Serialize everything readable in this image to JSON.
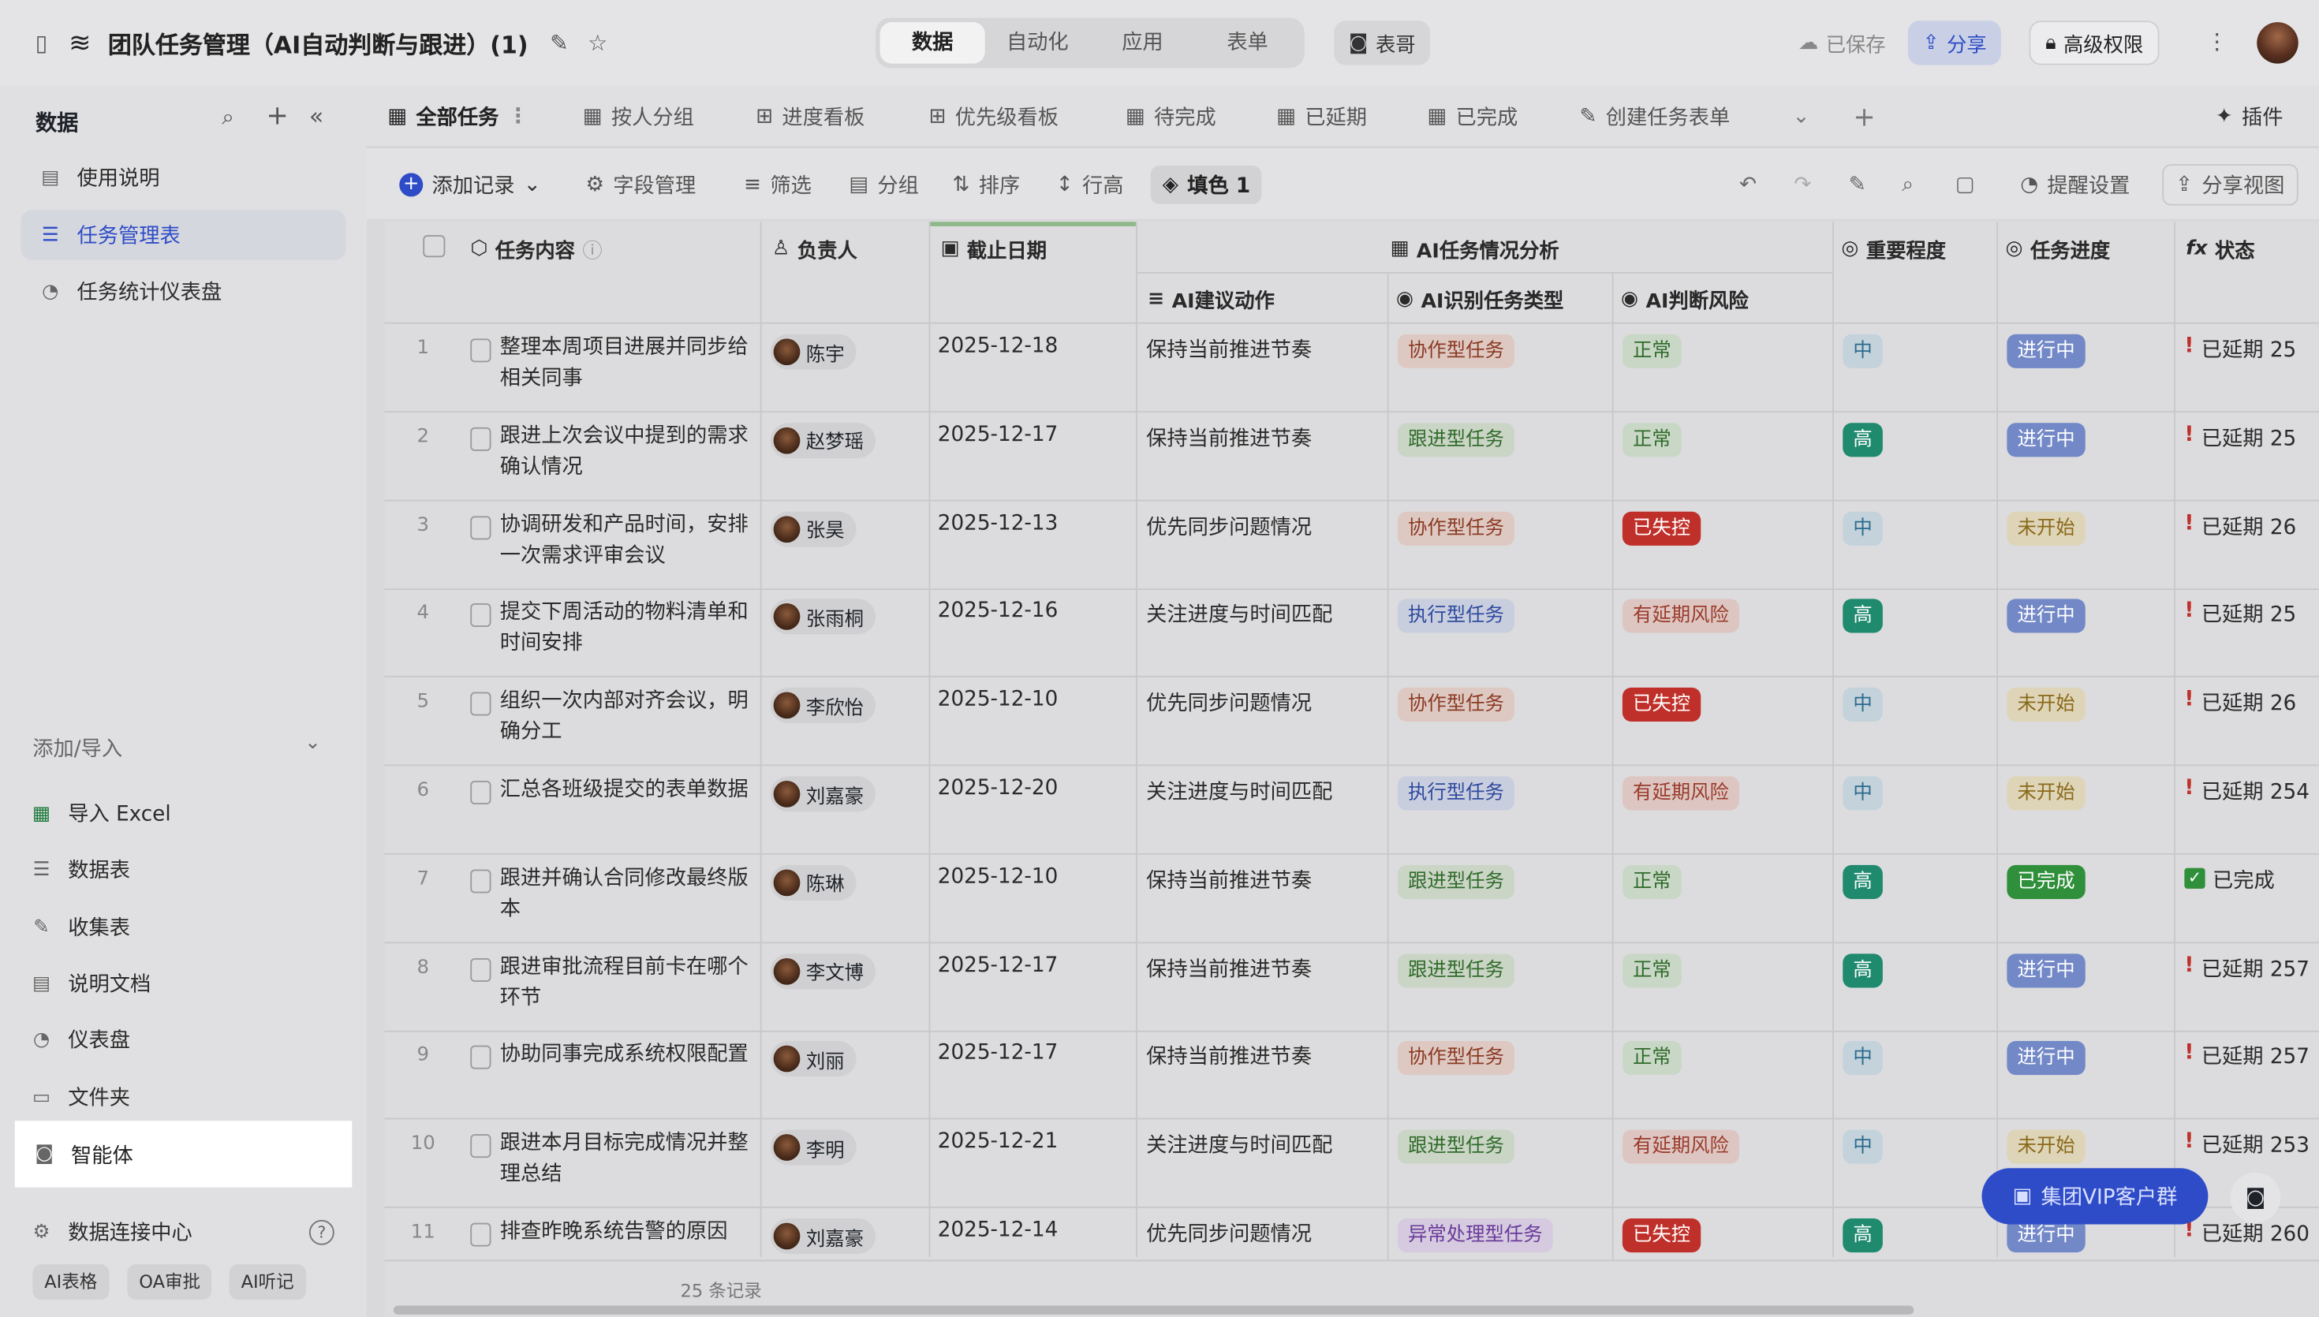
{
  "header": {
    "title": "团队任务管理（AI自动判断与跟进）(1)",
    "nav": [
      {
        "label": "数据",
        "active": true
      },
      {
        "label": "自动化"
      },
      {
        "label": "应用"
      },
      {
        "label": "表单"
      }
    ],
    "assistant": "表哥",
    "saved": "已保存",
    "share": "分享",
    "permission": "高级权限"
  },
  "sidebar": {
    "heading": "数据",
    "items": [
      {
        "label": "使用说明"
      },
      {
        "label": "任务管理表",
        "active": true
      },
      {
        "label": "任务统计仪表盘"
      }
    ],
    "add_import": "添加/导入",
    "create": [
      "导入 Excel",
      "数据表",
      "收集表",
      "说明文档",
      "仪表盘",
      "文件夹",
      "智能体"
    ],
    "connect": "数据连接中心",
    "tags": [
      "AI表格",
      "OA审批",
      "AI听记"
    ]
  },
  "tabs": [
    "全部任务",
    "按人分组",
    "进度看板",
    "优先级看板",
    "待完成",
    "已延期",
    "已完成",
    "创建任务表单"
  ],
  "plugin": "插件",
  "toolbar": {
    "add": "添加记录",
    "fields": "字段管理",
    "filter": "筛选",
    "group": "分组",
    "sort": "排序",
    "rowheight": "行高",
    "fill": "填色 1",
    "remind": "提醒设置",
    "shareview": "分享视图"
  },
  "columns": {
    "content": "任务内容",
    "owner": "负责人",
    "due": "截止日期",
    "ai_group": "AI任务情况分析",
    "ai_action": "AI建议动作",
    "ai_type": "AI识别任务类型",
    "ai_risk": "AI判断风险",
    "priority": "重要程度",
    "progress": "任务进度",
    "status": "状态"
  },
  "rows": [
    {
      "n": "1",
      "content": "整理本周项目进展并同步给相关同事",
      "owner": "陈宇",
      "due": "2025-12-18",
      "action": "保持当前推进节奏",
      "type": "协作型任务",
      "risk": "正常",
      "priority": "中",
      "progress": "进行中",
      "status": "已延期 25"
    },
    {
      "n": "2",
      "content": "跟进上次会议中提到的需求确认情况",
      "owner": "赵梦瑶",
      "due": "2025-12-17",
      "action": "保持当前推进节奏",
      "type": "跟进型任务",
      "risk": "正常",
      "priority": "高",
      "progress": "进行中",
      "status": "已延期 25"
    },
    {
      "n": "3",
      "content": "协调研发和产品时间，安排一次需求评审会议",
      "owner": "张昊",
      "due": "2025-12-13",
      "action": "优先同步问题情况",
      "type": "协作型任务",
      "risk": "已失控",
      "priority": "中",
      "progress": "未开始",
      "status": "已延期 26"
    },
    {
      "n": "4",
      "content": "提交下周活动的物料清单和时间安排",
      "owner": "张雨桐",
      "due": "2025-12-16",
      "action": "关注进度与时间匹配",
      "type": "执行型任务",
      "risk": "有延期风险",
      "priority": "高",
      "progress": "进行中",
      "status": "已延期 25"
    },
    {
      "n": "5",
      "content": "组织一次内部对齐会议，明确分工",
      "owner": "李欣怡",
      "due": "2025-12-10",
      "action": "优先同步问题情况",
      "type": "协作型任务",
      "risk": "已失控",
      "priority": "中",
      "progress": "未开始",
      "status": "已延期 26"
    },
    {
      "n": "6",
      "content": "汇总各班级提交的表单数据",
      "owner": "刘嘉豪",
      "due": "2025-12-20",
      "action": "关注进度与时间匹配",
      "type": "执行型任务",
      "risk": "有延期风险",
      "priority": "中",
      "progress": "未开始",
      "status": "已延期 254"
    },
    {
      "n": "7",
      "content": "跟进并确认合同修改最终版本",
      "owner": "陈琳",
      "due": "2025-12-10",
      "action": "保持当前推进节奏",
      "type": "跟进型任务",
      "risk": "正常",
      "priority": "高",
      "progress": "已完成",
      "status": "已完成"
    },
    {
      "n": "8",
      "content": "跟进审批流程目前卡在哪个环节",
      "owner": "李文博",
      "due": "2025-12-17",
      "action": "保持当前推进节奏",
      "type": "跟进型任务",
      "risk": "正常",
      "priority": "高",
      "progress": "进行中",
      "status": "已延期 257"
    },
    {
      "n": "9",
      "content": "协助同事完成系统权限配置",
      "owner": "刘丽",
      "due": "2025-12-17",
      "action": "保持当前推进节奏",
      "type": "协作型任务",
      "risk": "正常",
      "priority": "中",
      "progress": "进行中",
      "status": "已延期 257"
    },
    {
      "n": "10",
      "content": "跟进本月目标完成情况并整理总结",
      "owner": "李明",
      "due": "2025-12-21",
      "action": "关注进度与时间匹配",
      "type": "跟进型任务",
      "risk": "有延期风险",
      "priority": "中",
      "progress": "未开始",
      "status": "已延期 253"
    },
    {
      "n": "11",
      "content": "排查昨晚系统告警的原因",
      "owner": "刘嘉豪",
      "due": "2025-12-14",
      "action": "优先同步问题情况",
      "type": "异常处理型任务",
      "risk": "已失控",
      "priority": "高",
      "progress": "进行中",
      "status": "已延期 260"
    }
  ],
  "record_count": "25 条记录",
  "vip": "集团VIP客户群"
}
